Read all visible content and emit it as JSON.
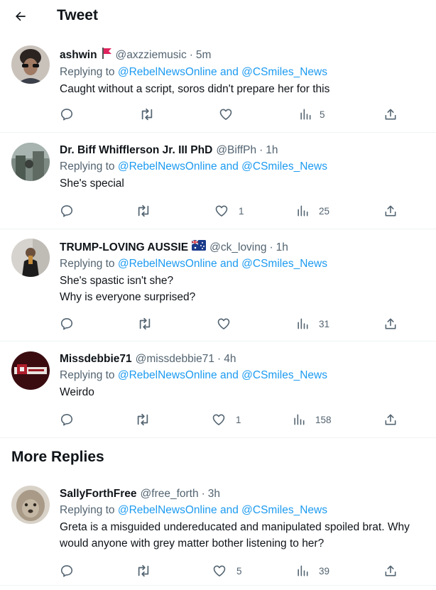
{
  "header": {
    "title": "Tweet"
  },
  "replying_label": "Replying to",
  "replying_and": "and",
  "mention_1": "@RebelNewsOnline",
  "mention_2": "@CSmiles_News",
  "tweets": [
    {
      "name": "ashwin",
      "flag": "red-flag-emoji",
      "handle": "@axzziemusic",
      "dot": "·",
      "time": "5m",
      "lines": [
        "Caught without  a script, soros didn't prepare her for this"
      ],
      "likes": "",
      "views": "5"
    },
    {
      "name": "Dr. Biff Whifflerson Jr. III PhD",
      "handle": "@BiffPh",
      "dot": "·",
      "time": "1h",
      "lines": [
        "She's special"
      ],
      "likes": "1",
      "views": "25"
    },
    {
      "name": "TRUMP-LOVING AUSSIE",
      "flag": "australia-flag-emoji",
      "handle": "@ck_loving",
      "dot": "·",
      "time": "1h",
      "lines": [
        "She's spastic isn't she?",
        "Why is everyone surprised?"
      ],
      "likes": "",
      "views": "31"
    },
    {
      "name": "Missdebbie71",
      "handle": "@missdebbie71",
      "dot": "·",
      "time": "4h",
      "lines": [
        "Weirdo"
      ],
      "likes": "1",
      "views": "158"
    },
    {
      "name": "SallyForthFree",
      "handle": "@free_forth",
      "dot": "·",
      "time": "3h",
      "lines": [
        "Greta is a misguided undereducated and manipulated spoiled brat. Why",
        "would anyone with grey matter bother listening to her?"
      ],
      "likes": "5",
      "views": "39"
    }
  ],
  "more_replies": "More Replies",
  "colors": {
    "accent": "#1d9bf0",
    "secondary_text": "#536471",
    "divider": "#eff3f4"
  }
}
